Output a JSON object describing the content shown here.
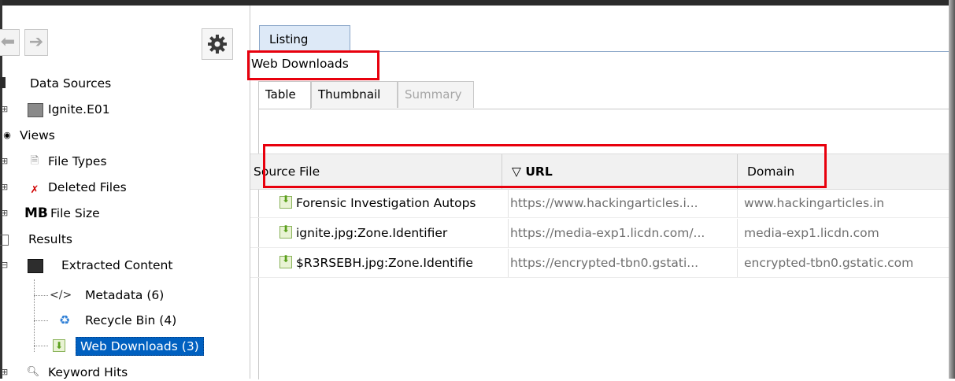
{
  "left_panel": {
    "back_glyph": "⬅",
    "forward_glyph": "➔",
    "tree": [
      {
        "label": "Data Sources",
        "icon": "database-icon"
      },
      {
        "label": "Ignite.E01",
        "icon": "disk-image-icon"
      },
      {
        "label": "Views",
        "icon": "views-icon"
      },
      {
        "label": "File Types",
        "icon": "file-types-icon"
      },
      {
        "label": "Deleted Files",
        "icon": "deleted-files-icon"
      },
      {
        "label": "File Size",
        "icon_text": "MB"
      },
      {
        "label": "Results",
        "icon": "results-icon"
      },
      {
        "label": "Extracted Content",
        "icon": "extracted-content-icon"
      },
      {
        "label": "Metadata (6)",
        "icon_text": "</>"
      },
      {
        "label": "Recycle Bin (4)",
        "icon": "recycle-bin-icon"
      },
      {
        "label": "Web Downloads (3)",
        "icon": "download-icon"
      },
      {
        "label": "Keyword Hits",
        "icon": "search-icon"
      }
    ]
  },
  "right_panel": {
    "top_tab": "Listing",
    "section_title": "Web Downloads",
    "tabs": [
      "Table",
      "Thumbnail",
      "Summary"
    ],
    "columns": [
      "Source File",
      "URL",
      "Domain"
    ],
    "sort_indicator": "▽",
    "rows": [
      {
        "source_file": "Forensic Investigation Autops",
        "url": "https://www.hackingarticles.i...",
        "domain": "www.hackingarticles.in"
      },
      {
        "source_file": "ignite.jpg:Zone.Identifier",
        "url": "https://media-exp1.licdn.com/...",
        "domain": "media-exp1.licdn.com"
      },
      {
        "source_file": "$R3RSEBH.jpg:Zone.Identifie",
        "url": "https://encrypted-tbn0.gstati...",
        "domain": "encrypted-tbn0.gstatic.com"
      }
    ]
  },
  "colors": {
    "highlight_box": "#e8000d",
    "selection": "#0060c0"
  }
}
